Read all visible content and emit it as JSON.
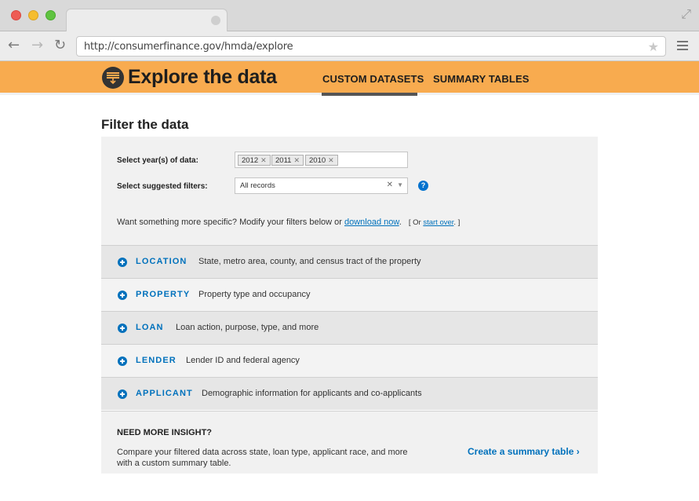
{
  "browser": {
    "url": "http://consumerfinance.gov/hmda/explore",
    "icons": [
      "back-arrow-icon",
      "forward-arrow-icon",
      "reload-icon",
      "star-icon",
      "menu-icon",
      "expand-icon"
    ]
  },
  "header": {
    "title": "Explore the data",
    "nav": [
      {
        "label": "CUSTOM DATASETS",
        "active": true
      },
      {
        "label": "SUMMARY TABLES",
        "active": false
      }
    ],
    "accent_color": "#f8ab4f"
  },
  "main": {
    "page_title": "Filter the data",
    "year_label": "Select year(s) of data:",
    "years": [
      "2012",
      "2011",
      "2010"
    ],
    "suggested_label": "Select suggested filters:",
    "suggested_value": "All records",
    "specific_prefix": "Want something more specific? Modify your filters below or",
    "download_link": "download now",
    "specific_suffix": ".",
    "or_text": "[ Or",
    "start_over": "start over",
    "or_end": ". ]",
    "link_color": "#0071bc"
  },
  "accordion": [
    {
      "title": "LOCATION",
      "desc": "State, metro area, county, and census tract of the property"
    },
    {
      "title": "PROPERTY",
      "desc": "Property type and occupancy"
    },
    {
      "title": "LOAN",
      "desc": "Loan action, purpose, type, and more"
    },
    {
      "title": "LENDER",
      "desc": "Lender ID and federal agency"
    },
    {
      "title": "APPLICANT",
      "desc": "Demographic information for applicants and co-applicants"
    }
  ],
  "insight": {
    "title": "NEED MORE INSIGHT?",
    "text": "Compare your filtered data across state, loan type, applicant race, and more with a custom summary table.",
    "link": "Create a summary table ›"
  }
}
